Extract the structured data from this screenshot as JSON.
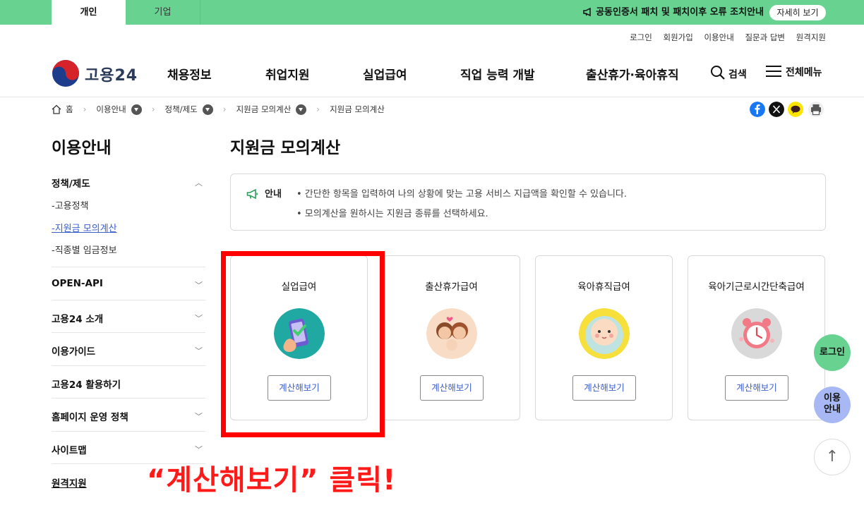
{
  "topbar": {
    "tab_personal": "개인",
    "tab_corporate": "기업",
    "notice": "공동인증서 패치 및 패치이후 오류 조치안내",
    "detail_button": "자세히 보기"
  },
  "util_links": [
    "로그인",
    "회원가입",
    "이용안내",
    "질문과 답변",
    "원격지원"
  ],
  "header": {
    "logo_text": "고용24",
    "nav": [
      "채용정보",
      "취업지원",
      "실업급여",
      "직업 능력 개발",
      "출산휴가·육아휴직"
    ],
    "search_label": "검색",
    "all_menu_label": "전체메뉴"
  },
  "breadcrumb": {
    "home": "홈",
    "items": [
      "이용안내",
      "정책/제도",
      "지원금 모의계산"
    ],
    "current": "지원금 모의계산"
  },
  "sidebar": {
    "title": "이용안내",
    "group_policy": "정책/제도",
    "sub_items": [
      "-고용정책",
      "-지원금 모의계산",
      "-직종별 임금정보"
    ],
    "groups": [
      "OPEN-API",
      "고용24 소개",
      "이용가이드",
      "고용24 활용하기",
      "홈페이지 운영 정책",
      "사이트맵",
      "원격지원"
    ]
  },
  "main": {
    "title": "지원금 모의계산",
    "info_label": "안내",
    "info_lines": [
      "• 간단한 항목을 입력하여 나의 상황에 맞는 고용 서비스 지급액을 확인할 수 있습니다.",
      "• 모의계산을 원하시는 지원금 종류를 선택하세요."
    ],
    "cards": [
      {
        "title": "실업급여",
        "button": "계산해보기",
        "icon": "phone-check-icon"
      },
      {
        "title": "출산휴가급여",
        "button": "계산해보기",
        "icon": "couple-baby-icon"
      },
      {
        "title": "육아휴직급여",
        "button": "계산해보기",
        "icon": "baby-face-icon"
      },
      {
        "title": "육아기근로시간단축급여",
        "button": "계산해보기",
        "icon": "alarm-clock-icon"
      }
    ]
  },
  "annotation": "“계산해보기” 클릭!",
  "floating": {
    "login": "로그인",
    "guide_line1": "이용",
    "guide_line2": "안내",
    "top": "↑"
  },
  "colors": {
    "topbar_green": "#68d391",
    "highlight_red": "#ff0000",
    "link_blue": "#3a5fcd",
    "guide_blue": "#a7b8f5"
  }
}
